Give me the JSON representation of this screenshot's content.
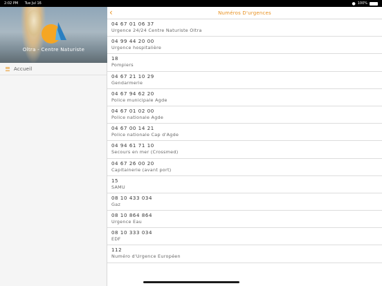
{
  "status_bar": {
    "time": "2:02 PM",
    "date": "Tue Jul 16",
    "battery": "100%"
  },
  "sidebar": {
    "hero_title": "Oltra - Centre Naturiste",
    "items": [
      {
        "label": "Accueil",
        "icon": "list-icon"
      }
    ]
  },
  "header": {
    "back_icon": "chevron-left-icon",
    "title": "Numéros D'urgences"
  },
  "contacts": [
    {
      "number": "04 67 01 06 37",
      "label": "Urgence 24/24 Centre Naturiste Oltra"
    },
    {
      "number": "04 99 44 20 00",
      "label": "Urgence hospitalière"
    },
    {
      "number": "18",
      "label": "Pompiers"
    },
    {
      "number": "04 67 21 10 29",
      "label": "Gendarmerie"
    },
    {
      "number": "04 67 94 62 20",
      "label": "Police municipale Agde"
    },
    {
      "number": "04 67 01 02 00",
      "label": "Police nationale Agde"
    },
    {
      "number": "04 67 00 14 21",
      "label": "Police nationale Cap d'Agde"
    },
    {
      "number": "04 94 61 71 10",
      "label": "Secours en mer (Crossmed)"
    },
    {
      "number": "04 67 26 00 20",
      "label": "Capitainerie (avant port)"
    },
    {
      "number": "15",
      "label": "SAMU"
    },
    {
      "number": "08 10 433 034",
      "label": "Gaz"
    },
    {
      "number": "08 10 864 864",
      "label": "Urgence Eau"
    },
    {
      "number": "08 10 333 034",
      "label": "EDF"
    },
    {
      "number": "112",
      "label": "Numéro d'Urgence Européen"
    }
  ],
  "colors": {
    "accent": "#e8901f",
    "logo_orange": "#f5a623",
    "logo_blue": "#2a7fc1"
  }
}
